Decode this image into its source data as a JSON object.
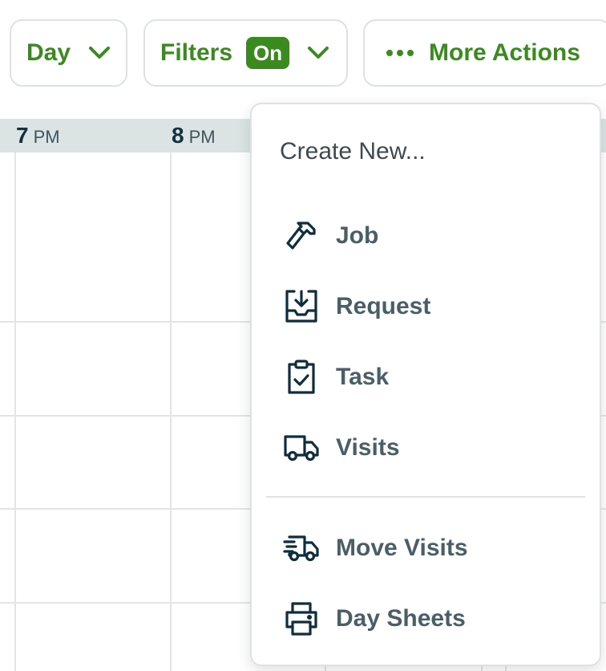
{
  "toolbar": {
    "day_label": "Day",
    "filters_label": "Filters",
    "filters_badge": "On",
    "more_actions_label": "More Actions"
  },
  "calendar": {
    "hours": [
      {
        "num": "7",
        "suffix": "PM"
      },
      {
        "num": "8",
        "suffix": "PM"
      }
    ]
  },
  "dropdown": {
    "title": "Create New...",
    "items": [
      {
        "label": "Job",
        "icon": "hammer-icon"
      },
      {
        "label": "Request",
        "icon": "inbox-download-icon"
      },
      {
        "label": "Task",
        "icon": "clipboard-check-icon"
      },
      {
        "label": "Visits",
        "icon": "truck-icon"
      },
      {
        "label": "Move Visits",
        "icon": "moving-truck-icon"
      },
      {
        "label": "Day Sheets",
        "icon": "printer-icon"
      }
    ]
  },
  "colors": {
    "accent_green": "#3a8a1f",
    "icon_dark": "#0f2e3d",
    "menu_text": "#4a5e68",
    "header_bg": "#dbe3e3"
  }
}
